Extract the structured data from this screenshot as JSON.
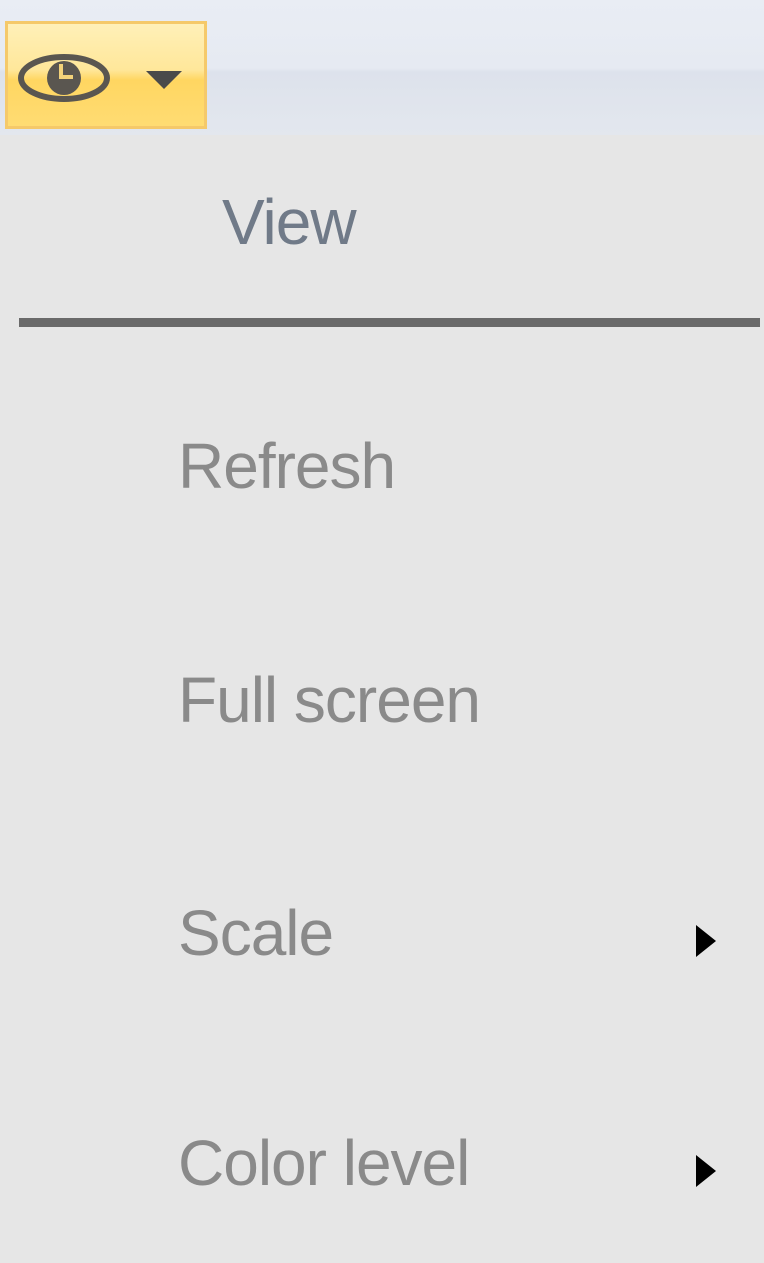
{
  "toolbar": {
    "view_button": {
      "icon": "eye-icon",
      "dropdown_icon": "chevron-down-icon"
    }
  },
  "menu": {
    "header": "View",
    "items": [
      {
        "label": "Refresh",
        "has_submenu": false
      },
      {
        "label": "Full screen",
        "has_submenu": false
      },
      {
        "label": "Scale",
        "has_submenu": true
      },
      {
        "label": "Color level",
        "has_submenu": true
      }
    ]
  },
  "colors": {
    "button_highlight": "#ffdc73",
    "button_border": "#f5c96a",
    "menu_background": "#e6e6e6",
    "disabled_text": "#8a8a8a",
    "header_text": "#707a88"
  }
}
